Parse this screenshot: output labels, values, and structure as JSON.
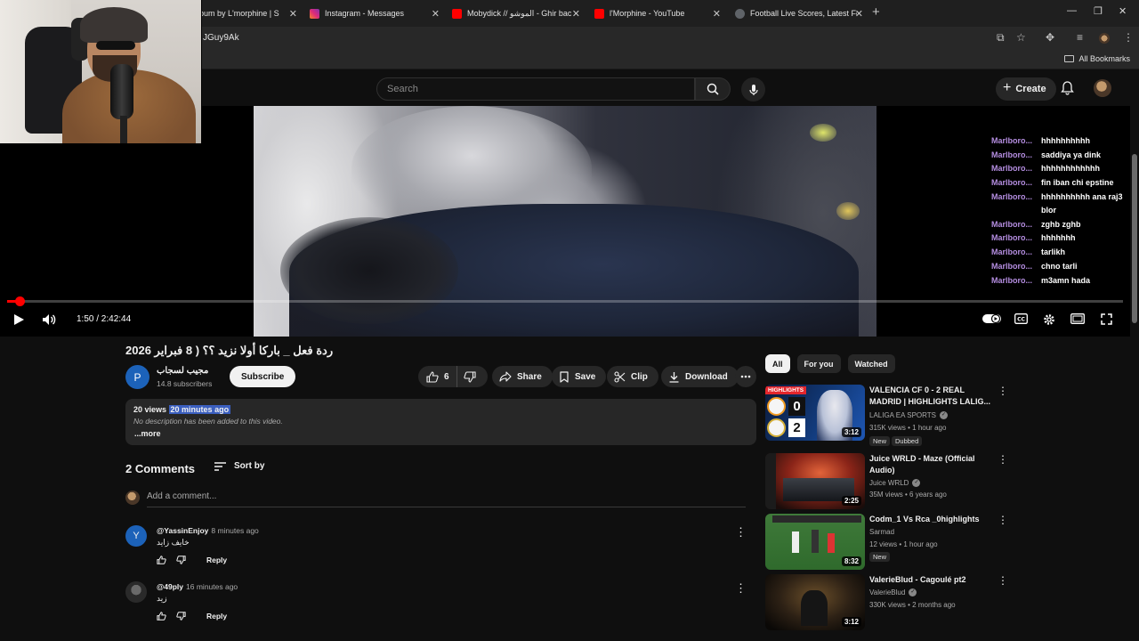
{
  "browser": {
    "tabs": [
      {
        "label": "Album by L'morphine | S",
        "color": "#1db954"
      },
      {
        "label": "Instagram - Messages",
        "color": "#e1306c"
      },
      {
        "label": "Mobydick // الموشو - Ghir bac",
        "color": "#ff0000"
      },
      {
        "label": "l'Morphine - YouTube",
        "color": "#ff0000"
      },
      {
        "label": "Football Live Scores, Latest Foo",
        "color": "#5f6368"
      }
    ],
    "url_fragment": "JGuy9Ak",
    "all_bookmarks": "All Bookmarks"
  },
  "masthead": {
    "search_placeholder": "Search",
    "create_label": "Create"
  },
  "player": {
    "time": "1:50 / 2:42:44",
    "progress_fraction": 0.0113,
    "chat": [
      {
        "user": "Marlboro...",
        "msg": "hhhhhhhhhh"
      },
      {
        "user": "Marlboro...",
        "msg": "saddiya ya dink"
      },
      {
        "user": "Marlboro...",
        "msg": "hhhhhhhhhhhh"
      },
      {
        "user": "Marlboro...",
        "msg": "fin iban chi epstine"
      },
      {
        "user": "Marlboro...",
        "msg": "hhhhhhhhhh ana raj3 blor"
      },
      {
        "user": "Marlboro...",
        "msg": "zghb zghb"
      },
      {
        "user": "Marlboro...",
        "msg": "hhhhhhh"
      },
      {
        "user": "Marlboro...",
        "msg": "tarlikh"
      },
      {
        "user": "Marlboro...",
        "msg": "chno tarli"
      },
      {
        "user": "Marlboro...",
        "msg": "m3amn hada"
      }
    ]
  },
  "video": {
    "title": "ردة فعل _ باركا أولا نزيد ؟؟ ( 8 فبراير 2026",
    "channel_initial": "P",
    "channel_name": "مجيب لسجاب",
    "subscribers": "14.8 subscribers",
    "subscribe_label": "Subscribe",
    "likes": "6",
    "share_label": "Share",
    "save_label": "Save",
    "clip_label": "Clip",
    "download_label": "Download",
    "views": "20 views",
    "uploaded": "20 minutes ago",
    "description": "No description has been added to this video.",
    "more_label": "...more"
  },
  "comments": {
    "heading": "2 Comments",
    "sort_label": "Sort by",
    "add_placeholder": "Add a comment...",
    "items": [
      {
        "initial": "Y",
        "author": "@YassinEnjoy",
        "time": "8 minutes ago",
        "text": "خايف زايد",
        "reply": "Reply",
        "avatar_color": "#1c62b9"
      },
      {
        "initial": "",
        "author": "@49ply",
        "time": "16 minutes ago",
        "text": "زيد",
        "reply": "Reply",
        "avatar_color": "#3a3a3a"
      }
    ]
  },
  "recommendations": {
    "chips": [
      "All",
      "For you",
      "Watched"
    ],
    "items": [
      {
        "title": "VALENCIA CF 0 - 2 REAL MADRID | HIGHLIGHTS LALIG...",
        "channel": "LALIGA EA SPORTS",
        "stats": "315K views • 1 hour ago",
        "duration": "3:12",
        "badges": [
          "New",
          "Dubbed"
        ],
        "thumb_label": "HIGHLIGHTS",
        "score_home": "0",
        "score_away": "2"
      },
      {
        "title": "Juice WRLD - Maze (Official Audio)",
        "channel": "Juice WRLD",
        "stats": "35M views • 6 years ago",
        "duration": "2:25",
        "badges": []
      },
      {
        "title": "Codm_1 Vs Rca _0highlights",
        "channel": "Sarmad",
        "stats": "12 views • 1 hour ago",
        "duration": "8:32",
        "badges": [
          "New"
        ]
      },
      {
        "title": "ValerieBlud - Cagoulé pt2",
        "channel": "ValerieBlud",
        "stats": "330K views • 2 months ago",
        "duration": "3:12",
        "badges": []
      }
    ]
  },
  "colors": {
    "accent_red": "#ff0000",
    "chat_user": "#b48de0",
    "highlight": "#3b5fbf"
  }
}
